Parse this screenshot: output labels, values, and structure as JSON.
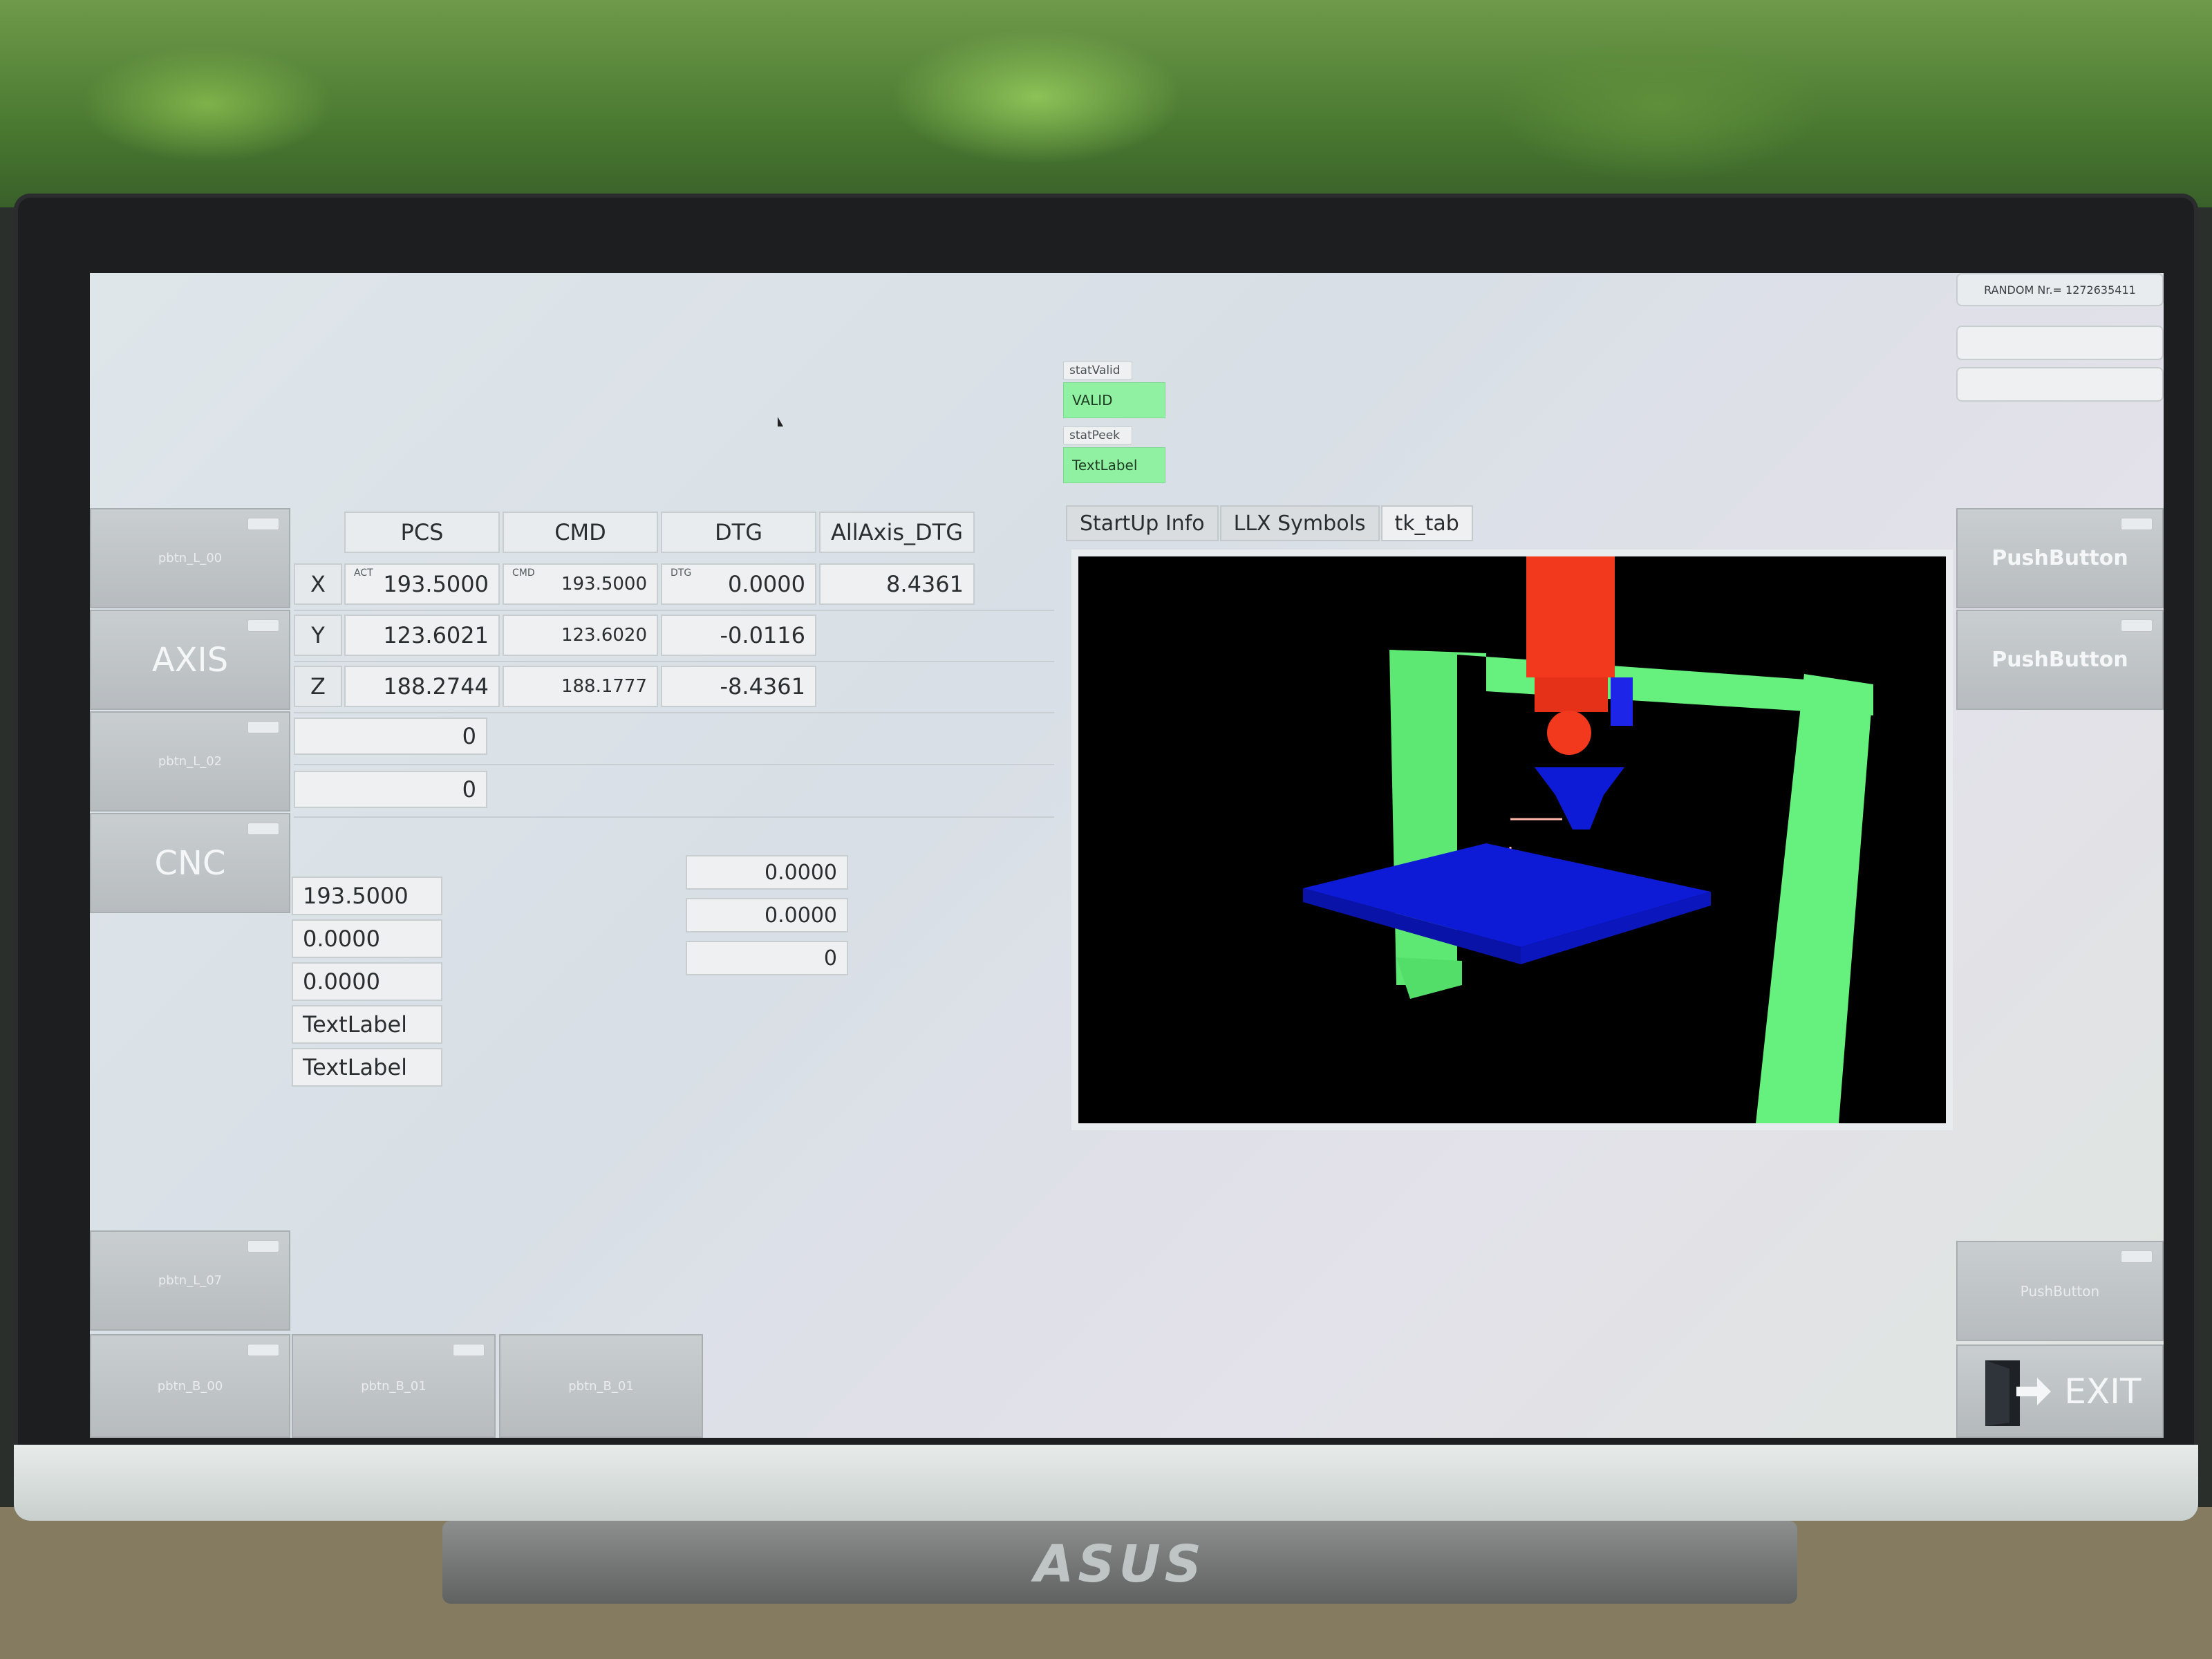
{
  "left_buttons": {
    "b0": "pbtn_L_00",
    "axis": "AXIS",
    "b2": "pbtn_L_02",
    "cnc": "CNC",
    "b7": "pbtn_L_07"
  },
  "bottom_buttons": [
    "pbtn_B_00",
    "pbtn_B_01",
    "pbtn_B_01"
  ],
  "right_buttons": {
    "random": "RANDOM Nr.= 1272635411",
    "push1": "PushButton",
    "push2": "PushButton",
    "push3": "PushButton",
    "exit": "EXIT"
  },
  "status": {
    "valid_label": "statValid",
    "valid_value": "VALID",
    "peek_label": "statPeek",
    "peek_value": "TextLabel"
  },
  "dro": {
    "headers": [
      "PCS",
      "CMD",
      "DTG",
      "AllAxis_DTG"
    ],
    "tags": {
      "act": "ACT",
      "cmd": "CMD",
      "dtg": "DTG"
    },
    "rows": [
      {
        "axis": "X",
        "pcs": "193.5000",
        "cmd": "193.5000",
        "dtg": "0.0000",
        "all": "8.4361"
      },
      {
        "axis": "Y",
        "pcs": "123.6021",
        "cmd": "123.6020",
        "dtg": "-0.0116"
      },
      {
        "axis": "Z",
        "pcs": "188.2744",
        "cmd": "188.1777",
        "dtg": "-8.4361"
      }
    ],
    "extra": [
      "0",
      "0"
    ]
  },
  "lower_left": [
    "193.5000",
    "0.0000",
    "0.0000",
    "TextLabel",
    "TextLabel"
  ],
  "lower_mid": [
    "0.0000",
    "0.0000",
    "0"
  ],
  "tabs": [
    "StartUp Info",
    "LLX Symbols",
    "tk_tab"
  ],
  "colors": {
    "status_green": "#8ff1a1",
    "frame_green": "#66f07d",
    "spindle_red": "#f2391e",
    "table_blue": "#0d1ad6"
  }
}
